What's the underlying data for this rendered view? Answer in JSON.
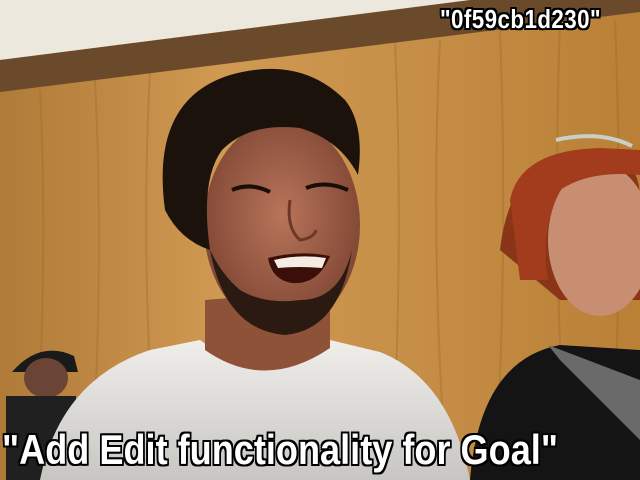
{
  "meme": {
    "top_text": "\"0f59cb1d230\"",
    "bottom_text": "\"Add Edit functionality for Goal\""
  },
  "colors": {
    "wall": "#c89248",
    "wall_dark": "#8a5a22",
    "ceiling": "#e8e4da",
    "hair": "#1c120c",
    "skin": "#a8644a",
    "shirt": "#e6e4e0",
    "red_hair": "#9a3a1c"
  }
}
